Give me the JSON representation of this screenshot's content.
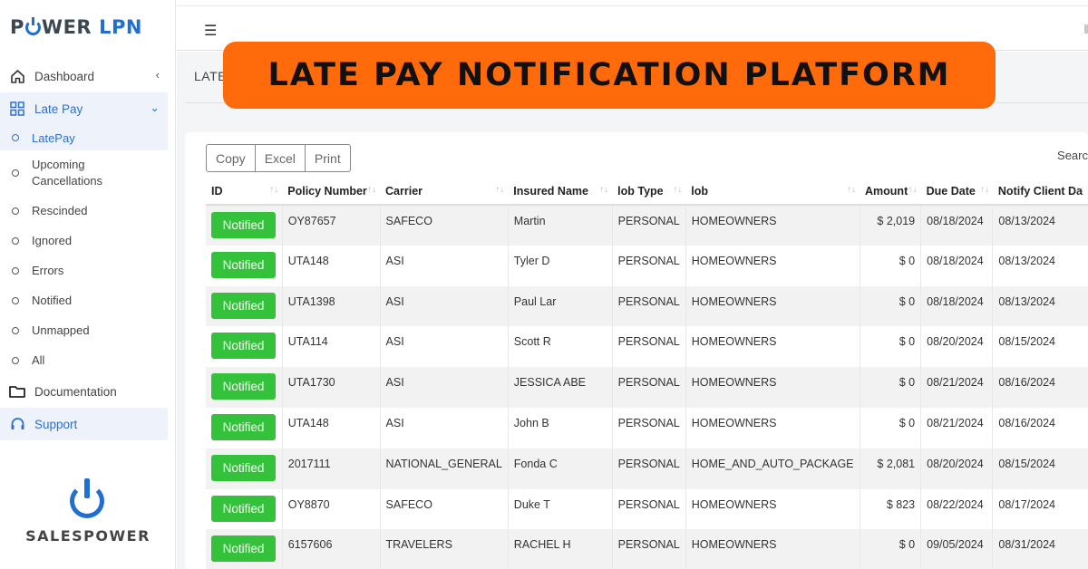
{
  "logo": {
    "power": "P",
    "ower": "WER",
    "lpn": "LPN"
  },
  "banner": "LATE PAY NOTIFICATION PLATFORM",
  "page_header_stub": "LATE",
  "nav": {
    "dashboard": "Dashboard",
    "late_pay": "Late Pay",
    "sub_items": [
      "LatePay",
      "Upcoming Cancellations",
      "Rescinded",
      "Ignored",
      "Errors",
      "Notified",
      "Unmapped",
      "All"
    ],
    "documentation": "Documentation",
    "support": "Support"
  },
  "brand": "SALESPOWER",
  "toolbar": {
    "copy": "Copy",
    "excel": "Excel",
    "print": "Print",
    "search": "Searc"
  },
  "table": {
    "columns": [
      "ID",
      "Policy Number",
      "Carrier",
      "Insured Name",
      "lob Type",
      "lob",
      "Amount",
      "Due Date",
      "Notify Client Da"
    ],
    "rows": [
      {
        "status": "Notified",
        "policy": "OY87657",
        "carrier": "SAFECO",
        "insured": "Martin",
        "lob_type": "PERSONAL",
        "lob": "HOMEOWNERS",
        "amount": "$ 2,019",
        "due": "08/18/2024",
        "notify": "08/13/2024"
      },
      {
        "status": "Notified",
        "policy": "UTA148",
        "carrier": "ASI",
        "insured": "Tyler D",
        "lob_type": "PERSONAL",
        "lob": "HOMEOWNERS",
        "amount": "$ 0",
        "due": "08/18/2024",
        "notify": "08/13/2024"
      },
      {
        "status": "Notified",
        "policy": "UTA1398",
        "carrier": "ASI",
        "insured": "Paul Lar",
        "lob_type": "PERSONAL",
        "lob": "HOMEOWNERS",
        "amount": "$ 0",
        "due": "08/18/2024",
        "notify": "08/13/2024"
      },
      {
        "status": "Notified",
        "policy": "UTA114",
        "carrier": "ASI",
        "insured": "Scott R",
        "lob_type": "PERSONAL",
        "lob": "HOMEOWNERS",
        "amount": "$ 0",
        "due": "08/20/2024",
        "notify": "08/15/2024"
      },
      {
        "status": "Notified",
        "policy": "UTA1730",
        "carrier": "ASI",
        "insured": "JESSICA ABE",
        "lob_type": "PERSONAL",
        "lob": "HOMEOWNERS",
        "amount": "$ 0",
        "due": "08/21/2024",
        "notify": "08/16/2024"
      },
      {
        "status": "Notified",
        "policy": "UTA148",
        "carrier": "ASI",
        "insured": "John B",
        "lob_type": "PERSONAL",
        "lob": "HOMEOWNERS",
        "amount": "$ 0",
        "due": "08/21/2024",
        "notify": "08/16/2024"
      },
      {
        "status": "Notified",
        "policy": "2017111",
        "carrier": "NATIONAL_GENERAL",
        "insured": "Fonda C",
        "lob_type": "PERSONAL",
        "lob": "HOME_AND_AUTO_PACKAGE",
        "amount": "$ 2,081",
        "due": "08/20/2024",
        "notify": "08/15/2024"
      },
      {
        "status": "Notified",
        "policy": "OY8870",
        "carrier": "SAFECO",
        "insured": "Duke T",
        "lob_type": "PERSONAL",
        "lob": "HOMEOWNERS",
        "amount": "$ 823",
        "due": "08/22/2024",
        "notify": "08/17/2024"
      },
      {
        "status": "Notified",
        "policy": "6157606",
        "carrier": "TRAVELERS",
        "insured": "RACHEL H",
        "lob_type": "PERSONAL",
        "lob": "HOMEOWNERS",
        "amount": "$ 0",
        "due": "09/05/2024",
        "notify": "08/31/2024"
      }
    ]
  },
  "colors": {
    "accent": "#1f6fd1",
    "banner": "#ff6b0a",
    "notified": "#33c23a"
  }
}
